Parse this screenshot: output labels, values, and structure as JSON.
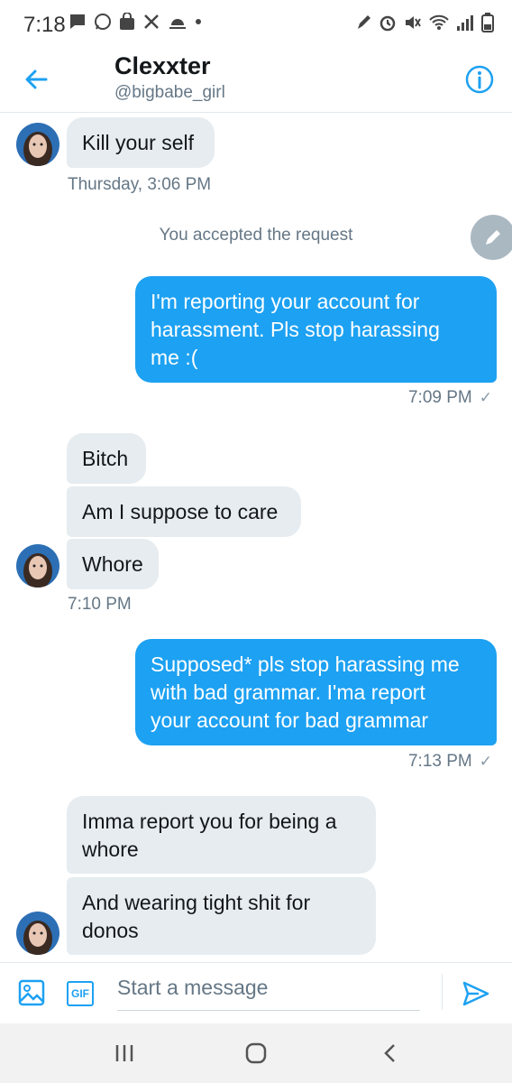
{
  "status_bar": {
    "time": "7:18",
    "left_icons": [
      "chat-icon",
      "whatsapp-icon",
      "shopping-bag-icon",
      "crossed-tools-icon",
      "weather-icon",
      "dot-icon"
    ],
    "right_icons": [
      "edit-icon",
      "alarm-icon",
      "mute-icon",
      "wifi-icon",
      "signal-icon",
      "battery-icon"
    ]
  },
  "header": {
    "title": "Clexxter",
    "handle": "@bigbabe_girl",
    "back_icon": "back-arrow-icon",
    "info_icon": "info-icon"
  },
  "messages": {
    "m1": "Kill your self",
    "t1": "Thursday, 3:06 PM",
    "system": "You accepted the request",
    "m2_line1": "I'm reporting your account for",
    "m2_line2": "harassment. Pls stop harassing",
    "m2_line3": "me :(",
    "t2": "7:09 PM",
    "m3": "Bitch",
    "m4": "Am I suppose to care",
    "m5": "Whore",
    "t3": "7:10 PM",
    "m6_line1": "Supposed* pls stop harassing me",
    "m6_line2": "with bad grammar. I'ma report",
    "m6_line3": "your account for bad grammar",
    "t4": "7:13 PM",
    "m7_line1": "Imma report you for being a",
    "m7_line2": "whore",
    "m8_line1": "And wearing tight shit for",
    "m8_line2": "donos",
    "check_mark": "✓"
  },
  "composer": {
    "placeholder": "Start a message",
    "gif_label": "GIF",
    "image_icon": "image-icon",
    "send_icon": "send-icon"
  },
  "colors": {
    "accent": "#1da1f2",
    "incoming_bubble": "#e6ecf0",
    "secondary_text": "#657786"
  }
}
